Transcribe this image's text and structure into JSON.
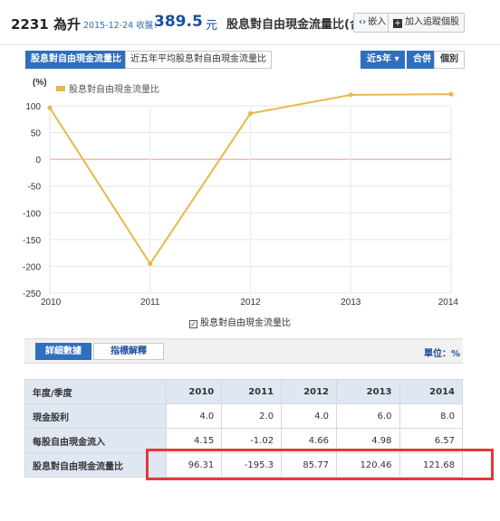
{
  "header": {
    "code_name": "2231 為升",
    "date_label": "2015-12-24 收盤：",
    "price": "389.5",
    "price_unit": "元",
    "metric_title": "股息對自由現金流量比(合併)",
    "embed_label": "嵌入",
    "watch_label": "加入追蹤個股"
  },
  "chart_tabs": [
    {
      "label": "股息對自由現金流量比",
      "active": true
    },
    {
      "label": "近五年平均股息對自由現金流量比",
      "active": false
    }
  ],
  "controls": {
    "period_label": "近5年",
    "period_arrow": "▾",
    "consolidated_label": "合併",
    "individual_label": "個別"
  },
  "chart_data": {
    "type": "line",
    "y_unit_label": "(%)",
    "legend": "股息對自由現金流量比",
    "legend_bottom": "股息對自由現金流量比",
    "x": [
      "2010",
      "2011",
      "2012",
      "2013",
      "2014"
    ],
    "series": [
      {
        "name": "股息對自由現金流量比",
        "values": [
          96.31,
          -195.3,
          85.77,
          120.46,
          121.68
        ],
        "color": "#e8b84a"
      }
    ],
    "ylim": [
      -250,
      100
    ],
    "yticks": [
      100,
      50,
      0,
      -50,
      -100,
      -150,
      -200,
      -250
    ],
    "zero_line_color": "#e39a9a",
    "grid": true
  },
  "details": {
    "tab_details": "詳細數據",
    "tab_explain": "指標解釋",
    "unit": "單位：%"
  },
  "table": {
    "header": [
      "年度/季度",
      "2010",
      "2011",
      "2012",
      "2013",
      "2014"
    ],
    "rows": [
      {
        "label": "現金股利",
        "values": [
          "4.0",
          "2.0",
          "4.0",
          "6.0",
          "8.0"
        ]
      },
      {
        "label": "每股自由現金流入",
        "values": [
          "4.15",
          "-1.02",
          "4.66",
          "4.98",
          "6.57"
        ]
      },
      {
        "label": "股息對自由現金流量比",
        "values": [
          "96.31",
          "-195.3",
          "85.77",
          "120.46",
          "121.68"
        ]
      }
    ]
  },
  "colors": {
    "accent": "#2f6fbf",
    "line": "#e8b84a",
    "highlight": "#e53935"
  }
}
